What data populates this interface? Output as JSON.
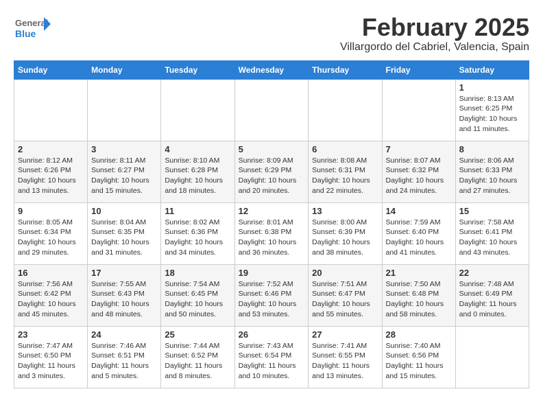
{
  "header": {
    "logo_general": "General",
    "logo_blue": "Blue",
    "month": "February 2025",
    "location": "Villargordo del Cabriel, Valencia, Spain"
  },
  "weekdays": [
    "Sunday",
    "Monday",
    "Tuesday",
    "Wednesday",
    "Thursday",
    "Friday",
    "Saturday"
  ],
  "weeks": [
    [
      null,
      null,
      null,
      null,
      null,
      null,
      {
        "day": 1,
        "sunrise": "8:13 AM",
        "sunset": "6:25 PM",
        "daylight": "10 hours and 11 minutes."
      }
    ],
    [
      {
        "day": 2,
        "sunrise": "8:12 AM",
        "sunset": "6:26 PM",
        "daylight": "10 hours and 13 minutes."
      },
      {
        "day": 3,
        "sunrise": "8:11 AM",
        "sunset": "6:27 PM",
        "daylight": "10 hours and 15 minutes."
      },
      {
        "day": 4,
        "sunrise": "8:10 AM",
        "sunset": "6:28 PM",
        "daylight": "10 hours and 18 minutes."
      },
      {
        "day": 5,
        "sunrise": "8:09 AM",
        "sunset": "6:29 PM",
        "daylight": "10 hours and 20 minutes."
      },
      {
        "day": 6,
        "sunrise": "8:08 AM",
        "sunset": "6:31 PM",
        "daylight": "10 hours and 22 minutes."
      },
      {
        "day": 7,
        "sunrise": "8:07 AM",
        "sunset": "6:32 PM",
        "daylight": "10 hours and 24 minutes."
      },
      {
        "day": 8,
        "sunrise": "8:06 AM",
        "sunset": "6:33 PM",
        "daylight": "10 hours and 27 minutes."
      }
    ],
    [
      {
        "day": 9,
        "sunrise": "8:05 AM",
        "sunset": "6:34 PM",
        "daylight": "10 hours and 29 minutes."
      },
      {
        "day": 10,
        "sunrise": "8:04 AM",
        "sunset": "6:35 PM",
        "daylight": "10 hours and 31 minutes."
      },
      {
        "day": 11,
        "sunrise": "8:02 AM",
        "sunset": "6:36 PM",
        "daylight": "10 hours and 34 minutes."
      },
      {
        "day": 12,
        "sunrise": "8:01 AM",
        "sunset": "6:38 PM",
        "daylight": "10 hours and 36 minutes."
      },
      {
        "day": 13,
        "sunrise": "8:00 AM",
        "sunset": "6:39 PM",
        "daylight": "10 hours and 38 minutes."
      },
      {
        "day": 14,
        "sunrise": "7:59 AM",
        "sunset": "6:40 PM",
        "daylight": "10 hours and 41 minutes."
      },
      {
        "day": 15,
        "sunrise": "7:58 AM",
        "sunset": "6:41 PM",
        "daylight": "10 hours and 43 minutes."
      }
    ],
    [
      {
        "day": 16,
        "sunrise": "7:56 AM",
        "sunset": "6:42 PM",
        "daylight": "10 hours and 45 minutes."
      },
      {
        "day": 17,
        "sunrise": "7:55 AM",
        "sunset": "6:43 PM",
        "daylight": "10 hours and 48 minutes."
      },
      {
        "day": 18,
        "sunrise": "7:54 AM",
        "sunset": "6:45 PM",
        "daylight": "10 hours and 50 minutes."
      },
      {
        "day": 19,
        "sunrise": "7:52 AM",
        "sunset": "6:46 PM",
        "daylight": "10 hours and 53 minutes."
      },
      {
        "day": 20,
        "sunrise": "7:51 AM",
        "sunset": "6:47 PM",
        "daylight": "10 hours and 55 minutes."
      },
      {
        "day": 21,
        "sunrise": "7:50 AM",
        "sunset": "6:48 PM",
        "daylight": "10 hours and 58 minutes."
      },
      {
        "day": 22,
        "sunrise": "7:48 AM",
        "sunset": "6:49 PM",
        "daylight": "11 hours and 0 minutes."
      }
    ],
    [
      {
        "day": 23,
        "sunrise": "7:47 AM",
        "sunset": "6:50 PM",
        "daylight": "11 hours and 3 minutes."
      },
      {
        "day": 24,
        "sunrise": "7:46 AM",
        "sunset": "6:51 PM",
        "daylight": "11 hours and 5 minutes."
      },
      {
        "day": 25,
        "sunrise": "7:44 AM",
        "sunset": "6:52 PM",
        "daylight": "11 hours and 8 minutes."
      },
      {
        "day": 26,
        "sunrise": "7:43 AM",
        "sunset": "6:54 PM",
        "daylight": "11 hours and 10 minutes."
      },
      {
        "day": 27,
        "sunrise": "7:41 AM",
        "sunset": "6:55 PM",
        "daylight": "11 hours and 13 minutes."
      },
      {
        "day": 28,
        "sunrise": "7:40 AM",
        "sunset": "6:56 PM",
        "daylight": "11 hours and 15 minutes."
      },
      null
    ]
  ]
}
